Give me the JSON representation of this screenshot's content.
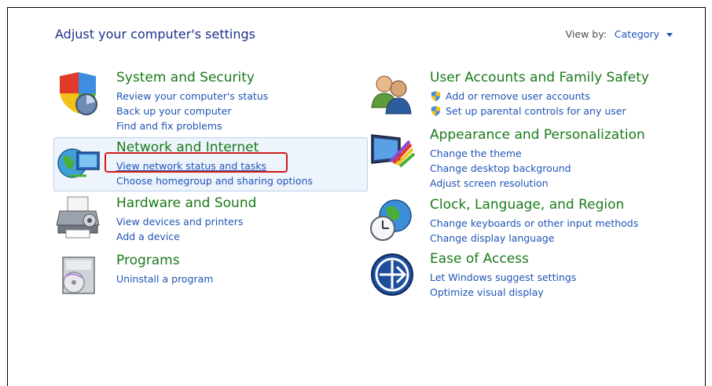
{
  "header": {
    "title": "Adjust your computer's settings",
    "view_by_label": "View by:",
    "view_by_value": "Category"
  },
  "left": [
    {
      "title": "System and Security",
      "icon": "shield-icon",
      "links": [
        "Review your computer's status",
        "Back up your computer",
        "Find and fix problems"
      ]
    },
    {
      "title": "Network and Internet",
      "icon": "network-globe-icon",
      "links": [
        "View network status and tasks",
        "Choose homegroup and sharing options"
      ]
    },
    {
      "title": "Hardware and Sound",
      "icon": "printer-icon",
      "links": [
        "View devices and printers",
        "Add a device"
      ]
    },
    {
      "title": "Programs",
      "icon": "programs-disc-icon",
      "links": [
        "Uninstall a program"
      ]
    }
  ],
  "right": [
    {
      "title": "User Accounts and Family Safety",
      "icon": "users-icon",
      "links": [
        "Add or remove user accounts",
        "Set up parental controls for any user"
      ]
    },
    {
      "title": "Appearance and Personalization",
      "icon": "monitor-palette-icon",
      "links": [
        "Change the theme",
        "Change desktop background",
        "Adjust screen resolution"
      ]
    },
    {
      "title": "Clock, Language, and Region",
      "icon": "clock-globe-icon",
      "links": [
        "Change keyboards or other input methods",
        "Change display language"
      ]
    },
    {
      "title": "Ease of Access",
      "icon": "ease-of-access-icon",
      "links": [
        "Let Windows suggest settings",
        "Optimize visual display"
      ]
    }
  ],
  "colors": {
    "title_green": "#1a7a1a",
    "link_blue": "#1f54b5",
    "highlight_red": "#d11a1a"
  }
}
